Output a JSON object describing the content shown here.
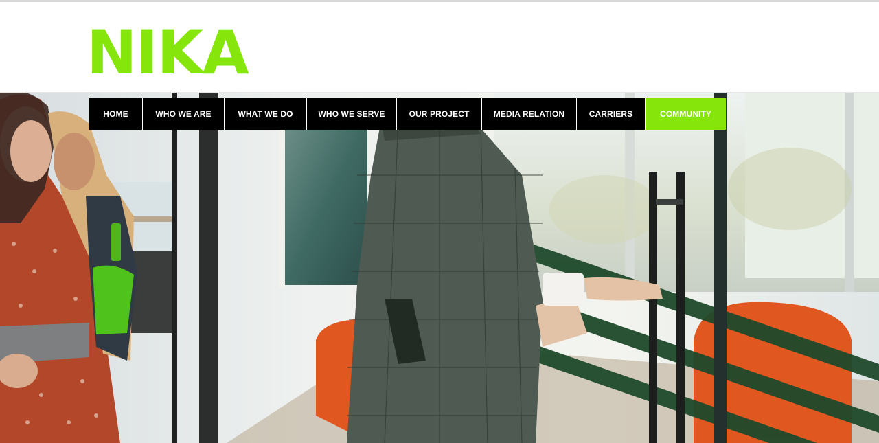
{
  "brand": {
    "name": "NIKA",
    "color": "#86e60b"
  },
  "nav": {
    "active_color": "#86e60b",
    "default_color": "#000000",
    "items": [
      {
        "label": "HOME",
        "active": false
      },
      {
        "label": "WHO WE ARE",
        "active": false
      },
      {
        "label": "WHAT WE DO",
        "active": false
      },
      {
        "label": "WHO WE SERVE",
        "active": false
      },
      {
        "label": "OUR PROJECT",
        "active": false
      },
      {
        "label": "MEDIA RELATION",
        "active": false
      },
      {
        "label": "CARRIERS",
        "active": false
      },
      {
        "label": "COMMUNITY",
        "active": true
      }
    ]
  },
  "hero": {
    "image": "office-team-walking-photo"
  }
}
